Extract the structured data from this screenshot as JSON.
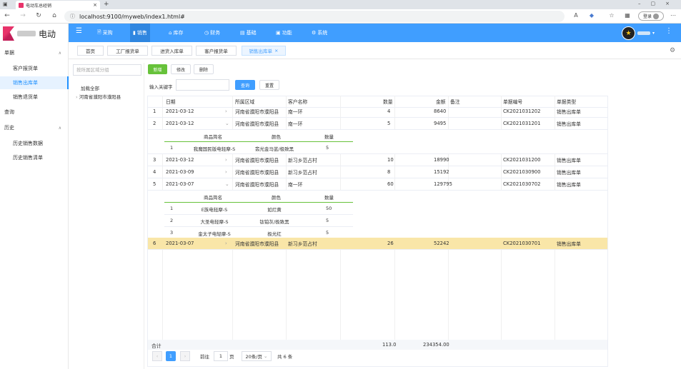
{
  "browser": {
    "tab_title": "电动车总经销",
    "url": "localhost:9100/myweb/index1.html#",
    "login_label": "登录"
  },
  "app": {
    "brand": "电动",
    "sidebar": {
      "groups": [
        {
          "label": "单据",
          "items": [
            "客户报货单",
            "销售出库单",
            "销售退货单"
          ]
        },
        {
          "label": "查询",
          "items": []
        },
        {
          "label": "历史",
          "items": [
            "历史销售数据",
            "历史销售清单"
          ]
        }
      ],
      "active_item": "销售出库单"
    },
    "topnav": [
      "采购",
      "销售",
      "库存",
      "财务",
      "基础",
      "功能",
      "系统"
    ],
    "active_nav": "销售",
    "page_tabs": [
      "首页",
      "工厂报货单",
      "进货入库单",
      "客户报货单",
      "销售出库单"
    ],
    "active_tab": "销售出库单",
    "filter": {
      "placeholder": "按所属区域分组",
      "tree": [
        "加载全部",
        "河南省濮阳市濮阳县"
      ]
    },
    "toolbar": {
      "add": "新增",
      "edit": "修改",
      "delete": "删除",
      "keyword_label": "输入关键字",
      "search": "查询",
      "reset": "重置"
    },
    "table": {
      "columns": [
        "日期",
        "所属区域",
        "客户名称",
        "数量",
        "金额",
        "备注",
        "单据编号",
        "单据类型"
      ],
      "rows": [
        {
          "no": "1",
          "date": "2021-03-12",
          "region": "河南省濮阳市濮阳县",
          "customer": "南一环",
          "qty": "4",
          "amount": "8640",
          "note": "",
          "code": "CK2021031202",
          "type": "销售出库单",
          "expanded": false
        },
        {
          "no": "2",
          "date": "2021-03-12",
          "region": "河南省濮阳市濮阳县",
          "customer": "南一环",
          "qty": "5",
          "amount": "9495",
          "note": "",
          "code": "CK2021031201",
          "type": "销售出库单",
          "expanded": true
        },
        {
          "no": "3",
          "date": "2021-03-12",
          "region": "河南省濮阳市濮阳县",
          "customer": "新习乡范占村",
          "qty": "10",
          "amount": "18990",
          "note": "",
          "code": "CK2021031200",
          "type": "销售出库单",
          "expanded": false
        },
        {
          "no": "4",
          "date": "2021-03-09",
          "region": "河南省濮阳市濮阳县",
          "customer": "新习乡范占村",
          "qty": "8",
          "amount": "15192",
          "note": "",
          "code": "CK2021030900",
          "type": "销售出库单",
          "expanded": false
        },
        {
          "no": "5",
          "date": "2021-03-07",
          "region": "河南省濮阳市濮阳县",
          "customer": "南一环",
          "qty": "60",
          "amount": "129795",
          "note": "",
          "code": "CK2021030702",
          "type": "销售出库单",
          "expanded": true
        },
        {
          "no": "6",
          "date": "2021-03-07",
          "region": "河南省濮阳市濮阳县",
          "customer": "新习乡范占村",
          "qty": "26",
          "amount": "52242",
          "note": "",
          "code": "CK2021030701",
          "type": "销售出库单",
          "expanded": false
        }
      ],
      "sub_columns": [
        "商品简名",
        "颜色",
        "数量"
      ],
      "sub_row2": [
        {
          "no": "1",
          "name": "我魔国民版电轻摩-S",
          "color": "翡光金马蓝/极致黑",
          "qty": "5"
        }
      ],
      "sub_row5": [
        {
          "no": "1",
          "name": "E族电轻摩-S",
          "color": "如烂黄",
          "qty": "50"
        },
        {
          "no": "2",
          "name": "大圣电轻摩-S",
          "color": "钛铂灰/极致黑",
          "qty": "5"
        },
        {
          "no": "3",
          "name": "金太子电轻摩-S",
          "color": "极光红",
          "qty": "5"
        }
      ],
      "total_label": "合计",
      "total_qty": "113.0",
      "total_amount": "234354.00"
    },
    "pager": {
      "current": "1",
      "goto_label": "前往",
      "goto_value": "1",
      "page_suffix": "页",
      "page_size": "20条/页",
      "total": "共 6 条"
    }
  }
}
